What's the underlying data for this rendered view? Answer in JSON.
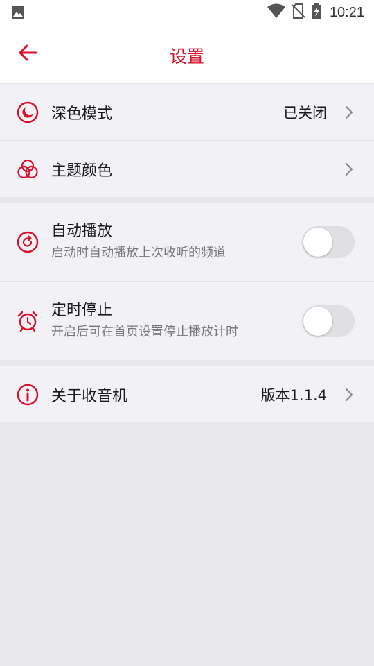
{
  "status_bar": {
    "time": "10:21",
    "icons": [
      "gallery-icon",
      "wifi-icon",
      "no-sim-icon",
      "battery-charging-icon"
    ]
  },
  "app_bar": {
    "title": "设置",
    "back_icon": "arrow-left-icon"
  },
  "colors": {
    "accent": "#d8102a",
    "row_background": "#f2f2f6",
    "page_background": "#e8e8eb"
  },
  "settings": {
    "dark_mode": {
      "label": "深色模式",
      "value": "已关闭",
      "icon": "moon-icon"
    },
    "theme_color": {
      "label": "主题颜色",
      "icon": "color-circles-icon"
    },
    "auto_play": {
      "label": "自动播放",
      "description": "启动时自动播放上次收听的频道",
      "enabled": false,
      "icon": "replay-icon"
    },
    "timed_stop": {
      "label": "定时停止",
      "description": "开启后可在首页设置停止播放计时",
      "enabled": false,
      "icon": "alarm-clock-icon"
    },
    "about": {
      "label": "关于收音机",
      "value": "版本1.1.4",
      "icon": "info-icon"
    }
  }
}
